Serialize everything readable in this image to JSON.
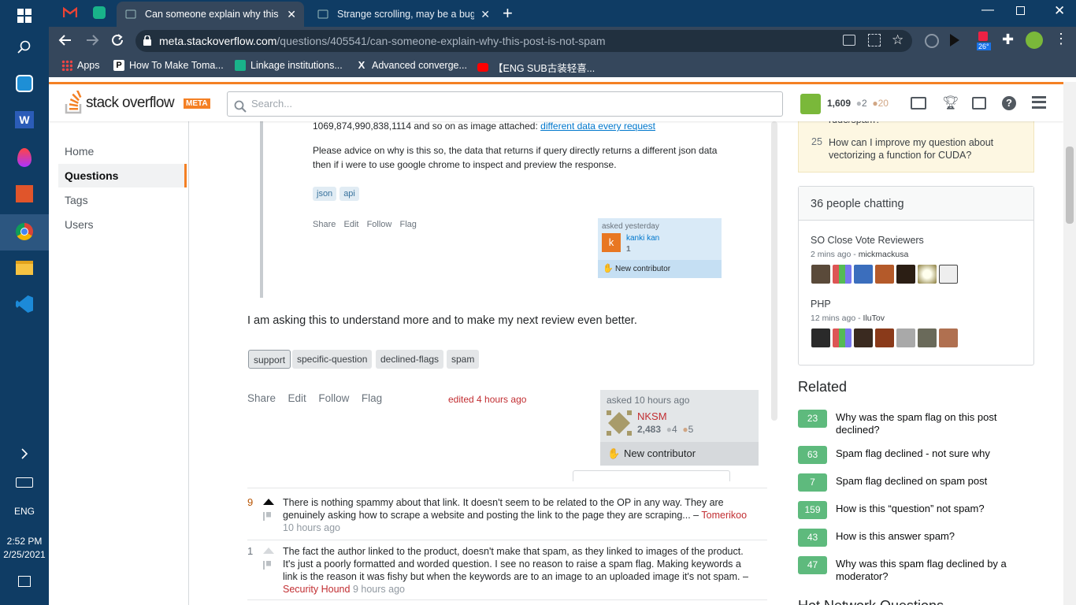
{
  "taskbar": {
    "lang": "ENG",
    "time": "2:52 PM",
    "date": "2/25/2021"
  },
  "tabs": [
    {
      "label": "Can someone explain why this po"
    },
    {
      "label": "Strange scrolling, may be a bug -"
    }
  ],
  "address": {
    "host": "meta.stackoverflow.com",
    "path": "/questions/405541/can-someone-explain-why-this-post-is-not-spam"
  },
  "extension_badge": "26°",
  "bookmarks": [
    {
      "label": "Apps"
    },
    {
      "label": "How To Make Toma..."
    },
    {
      "label": "Linkage institutions..."
    },
    {
      "label": "Advanced converge..."
    },
    {
      "label": "【ENG SUB古装轻喜..."
    }
  ],
  "header": {
    "logo_text": "stack overflow",
    "logo_badge": "META",
    "search_placeholder": "Search...",
    "reputation": "1,609",
    "silver": "2",
    "bronze": "20"
  },
  "nav": [
    {
      "label": "Home"
    },
    {
      "label": "Questions"
    },
    {
      "label": "Tags"
    },
    {
      "label": "Users"
    }
  ],
  "quoted": {
    "line1": "1069,874,990,838,1114 and so on as image attached:",
    "link": "different data every request",
    "para": "Please advice on why is this so, the data that returns if query directly returns a different json data then if i were to use google chrome to inspect and preview the response.",
    "tags": [
      "json",
      "api"
    ],
    "actions": [
      "Share",
      "Edit",
      "Follow",
      "Flag"
    ],
    "asked": "asked yesterday",
    "user": "kanki kan",
    "user_rep": "1",
    "user_avatar": "k",
    "new_contributor": "New contributor"
  },
  "post": {
    "body_end": "I am asking this to understand more and to make my next review even better.",
    "tags": [
      "support",
      "specific-question",
      "declined-flags",
      "spam"
    ],
    "actions": [
      "Share",
      "Edit",
      "Follow",
      "Flag"
    ],
    "edited": "edited 4 hours ago",
    "asked": "asked 10 hours ago",
    "user": "NKSM",
    "rep": "2,483",
    "silver": "4",
    "bronze": "5",
    "new_contributor": "New contributor"
  },
  "comments": [
    {
      "score": "9",
      "text": "There is nothing spammy about that link. It doesn't seem to be related to the OP in any way. They are genuinely asking how to scrape a website and posting the link to the page they are scraping... –",
      "user": "Tomerikoo",
      "time": "10 hours ago"
    },
    {
      "score": "1",
      "text": "The fact the author linked to the product, doesn't make that spam, as they linked to images of the product. It's just a poorly formatted and worded question. I see no reason to raise a spam flag. Making keywords a link is the reason it was fishy but when the keywords are to an image to an uploaded image it's not spam. –",
      "user": "Security Hound",
      "time": "9 hours ago"
    }
  ],
  "sidebar": {
    "featured_partial": "rude/spam?",
    "featured_item": {
      "num": "25",
      "text": "How can I improve my question about vectorizing a function for CUDA?"
    },
    "chat_title": "36 people chatting",
    "rooms": [
      {
        "name": "SO Close Vote Reviewers",
        "ago": "2 mins ago",
        "by": "mickmackusa"
      },
      {
        "name": "PHP",
        "ago": "12 mins ago",
        "by": "IluTov"
      }
    ],
    "related_title": "Related",
    "related": [
      {
        "score": "23",
        "text": "Why was the spam flag on this post declined?"
      },
      {
        "score": "63",
        "text": "Spam flag declined - not sure why"
      },
      {
        "score": "7",
        "text": "Spam flag declined on spam post"
      },
      {
        "score": "159",
        "text": "How is this “question” not spam?"
      },
      {
        "score": "43",
        "text": "How is this answer spam?"
      },
      {
        "score": "47",
        "text": "Why was this spam flag declined by a moderator?"
      }
    ],
    "hot_partial": "Hot Network Questions"
  }
}
